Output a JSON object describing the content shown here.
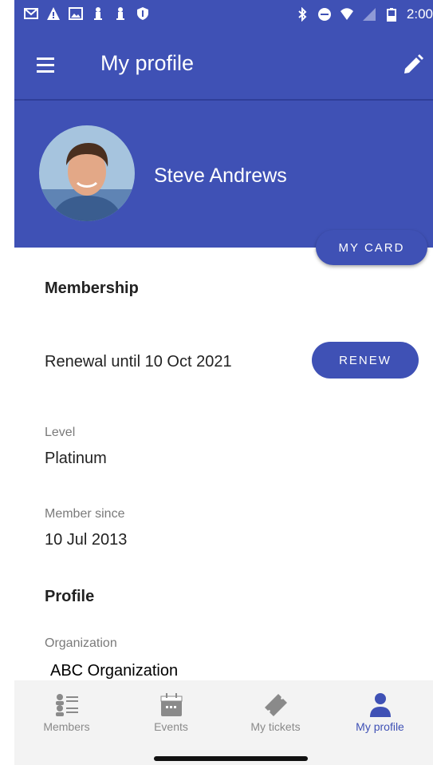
{
  "status_bar": {
    "time": "2:00"
  },
  "app_bar": {
    "title": "My profile"
  },
  "profile": {
    "name": "Steve Andrews",
    "my_card_label": "MY CARD"
  },
  "membership": {
    "section_title": "Membership",
    "renewal_text": "Renewal until 10 Oct 2021",
    "renew_label": "RENEW",
    "level_label": "Level",
    "level_value": "Platinum",
    "member_since_label": "Member since",
    "member_since_value": "10 Jul 2013"
  },
  "profile_section": {
    "section_title": "Profile",
    "organization_label": "Organization",
    "organization_value": "ABC Organization"
  },
  "bottom_nav": {
    "items": [
      {
        "label": "Members",
        "icon": "members-icon"
      },
      {
        "label": "Events",
        "icon": "calendar-icon"
      },
      {
        "label": "My tickets",
        "icon": "ticket-icon"
      },
      {
        "label": "My profile",
        "icon": "person-icon"
      }
    ],
    "active_index": 3
  },
  "colors": {
    "primary": "#3f51b5",
    "inactive": "#8a8a8a"
  }
}
